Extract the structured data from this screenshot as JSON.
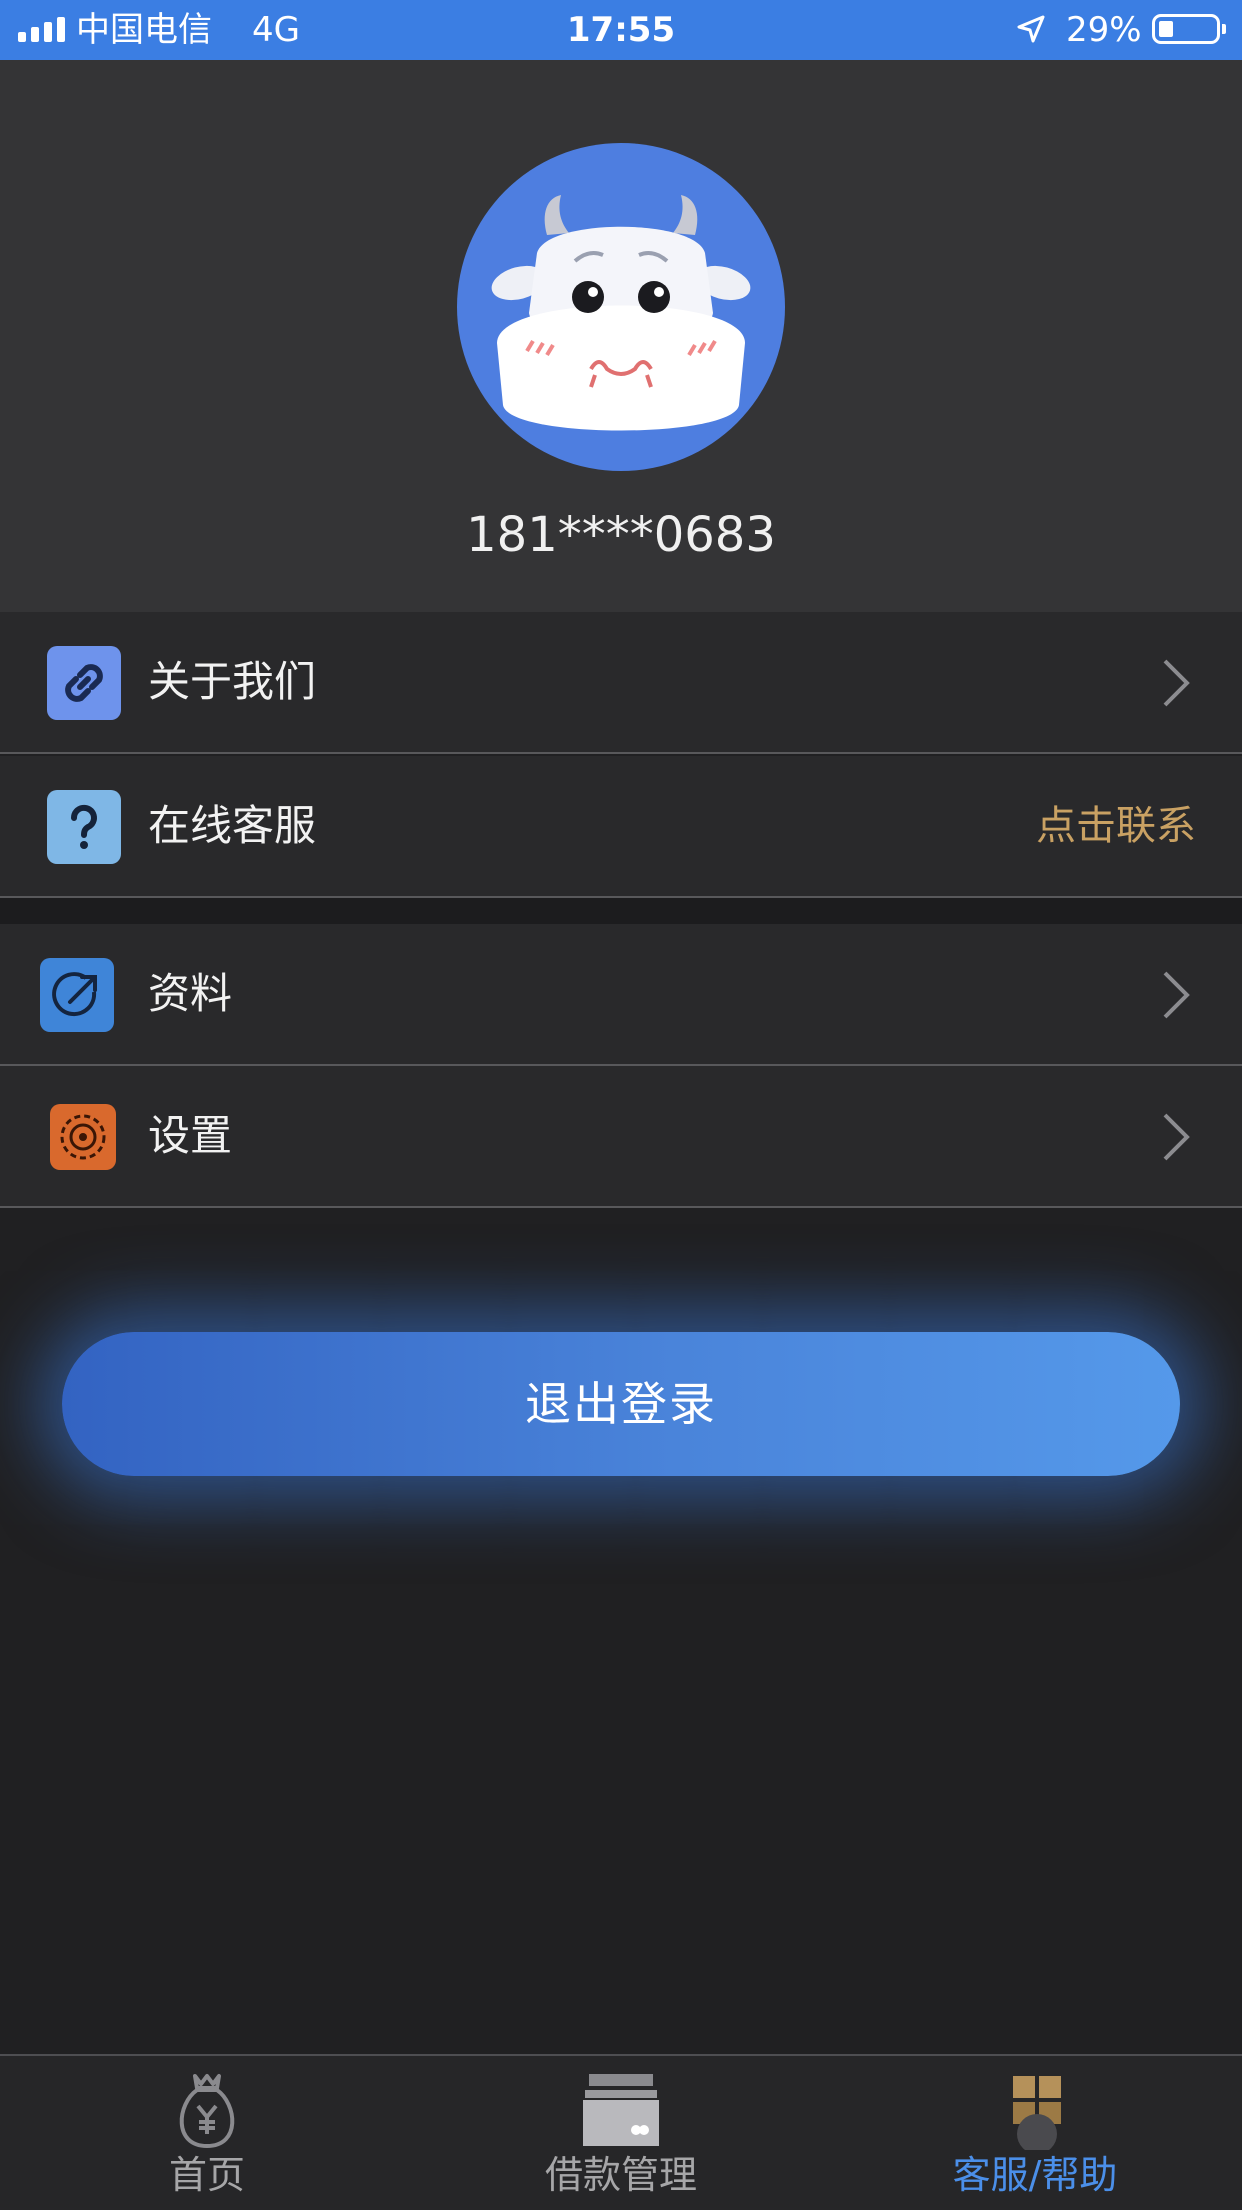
{
  "status_bar": {
    "carrier": "中国电信",
    "network": "4G",
    "time": "17:55",
    "battery_percent": "29%",
    "battery_level": 0.29,
    "icons": [
      "signal-icon",
      "location-arrow-icon",
      "battery-icon"
    ]
  },
  "profile": {
    "avatar": "cow-avatar",
    "phone": "181****0683"
  },
  "menu": {
    "items": [
      {
        "label": "关于我们",
        "icon": "link-icon",
        "icon_color": "#6e93ec"
      },
      {
        "label": "在线客服",
        "icon": "question-icon",
        "icon_color": "#7fb7e6",
        "action": "点击联系"
      },
      {
        "label": "资料",
        "icon": "external-link-icon",
        "icon_color": "#3f85d8"
      },
      {
        "label": "设置",
        "icon": "gear-icon",
        "icon_color": "#d9692d"
      }
    ]
  },
  "logout": {
    "label": "退出登录"
  },
  "tab_bar": {
    "tabs": [
      {
        "label": "首页",
        "icon": "money-bag-icon",
        "active": false
      },
      {
        "label": "借款管理",
        "icon": "card-icon",
        "active": false
      },
      {
        "label": "客服/帮助",
        "icon": "help-icon",
        "active": true
      }
    ]
  },
  "colors": {
    "status_bar": "#3b7ee3",
    "accent": "#4b8fe9",
    "action_text": "#c9a163",
    "background": "#202022"
  }
}
